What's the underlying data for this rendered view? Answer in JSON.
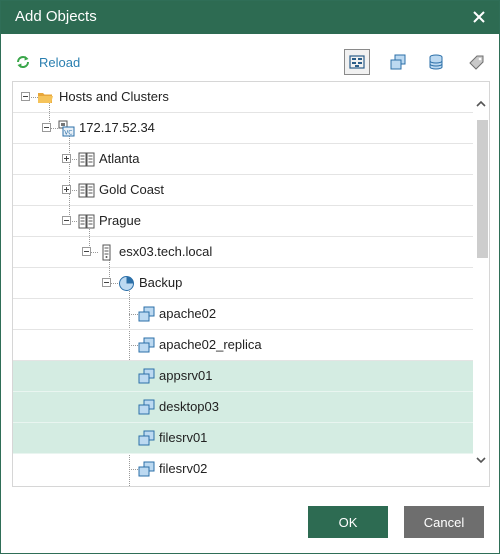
{
  "window": {
    "title": "Add Objects"
  },
  "toolbar": {
    "reload_label": "Reload",
    "view_buttons": [
      "hosts-and-clusters-view-icon",
      "vms-and-templates-view-icon",
      "datastores-view-icon",
      "tags-view-icon"
    ]
  },
  "tree": {
    "items": [
      {
        "label": "Hosts and Clusters",
        "icon": "folder-icon",
        "expanded": true
      },
      {
        "label": "172.17.52.34",
        "icon": "vcenter-icon",
        "expanded": true
      },
      {
        "label": "Atlanta",
        "icon": "datacenter-icon",
        "expanded": false
      },
      {
        "label": "Gold Coast",
        "icon": "datacenter-icon",
        "expanded": false
      },
      {
        "label": "Prague",
        "icon": "datacenter-icon",
        "expanded": true
      },
      {
        "label": "esx03.tech.local",
        "icon": "host-icon",
        "expanded": true
      },
      {
        "label": "Backup",
        "icon": "resource-pool-icon",
        "expanded": true
      },
      {
        "label": "apache02",
        "icon": "vm-icon",
        "selected": false
      },
      {
        "label": "apache02_replica",
        "icon": "vm-icon",
        "selected": false
      },
      {
        "label": "appsrv01",
        "icon": "vm-icon",
        "selected": true
      },
      {
        "label": "desktop03",
        "icon": "vm-icon",
        "selected": true
      },
      {
        "label": "filesrv01",
        "icon": "vm-icon",
        "selected": true
      },
      {
        "label": "filesrv02",
        "icon": "vm-icon",
        "selected": false
      }
    ]
  },
  "buttons": {
    "ok": "OK",
    "cancel": "Cancel"
  },
  "colors": {
    "titlebar": "#2d6b52",
    "selection": "#d4ece2",
    "link": "#2a7fb0",
    "cancel": "#6e6e6e"
  }
}
